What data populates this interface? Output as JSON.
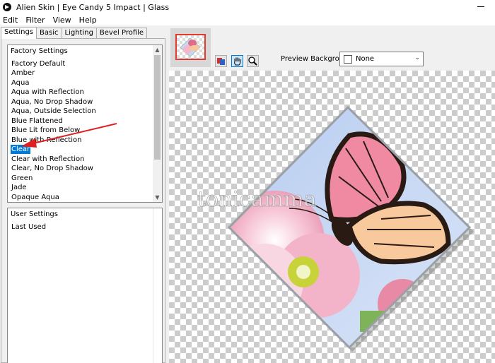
{
  "window": {
    "title": "Alien Skin | Eye Candy 5 Impact | Glass"
  },
  "menu": [
    "Edit",
    "Filter",
    "View",
    "Help"
  ],
  "tabs": [
    "Settings",
    "Basic",
    "Lighting",
    "Bevel Profile"
  ],
  "factory": {
    "header": "Factory Settings",
    "items": [
      "Factory Default",
      "Amber",
      "Aqua",
      "Aqua with Reflection",
      "Aqua, No Drop Shadow",
      "Aqua, Outside Selection",
      "Blue Flattened",
      "Blue Lit from Below",
      "Blue with Reflection",
      "Clear",
      "Clear with Reflection",
      "Clear, No Drop Shadow",
      "Green",
      "Jade",
      "Opaque Aqua"
    ],
    "selected": "Clear"
  },
  "user": {
    "header": "User Settings",
    "items": [
      "Last Used"
    ]
  },
  "preview": {
    "background_label": "Preview Background:",
    "background_value": "None"
  },
  "watermark": "tonicamma",
  "colors": {
    "selection": "#0078d7",
    "arrow": "#e02020",
    "thumb_border": "#e03b2e"
  }
}
